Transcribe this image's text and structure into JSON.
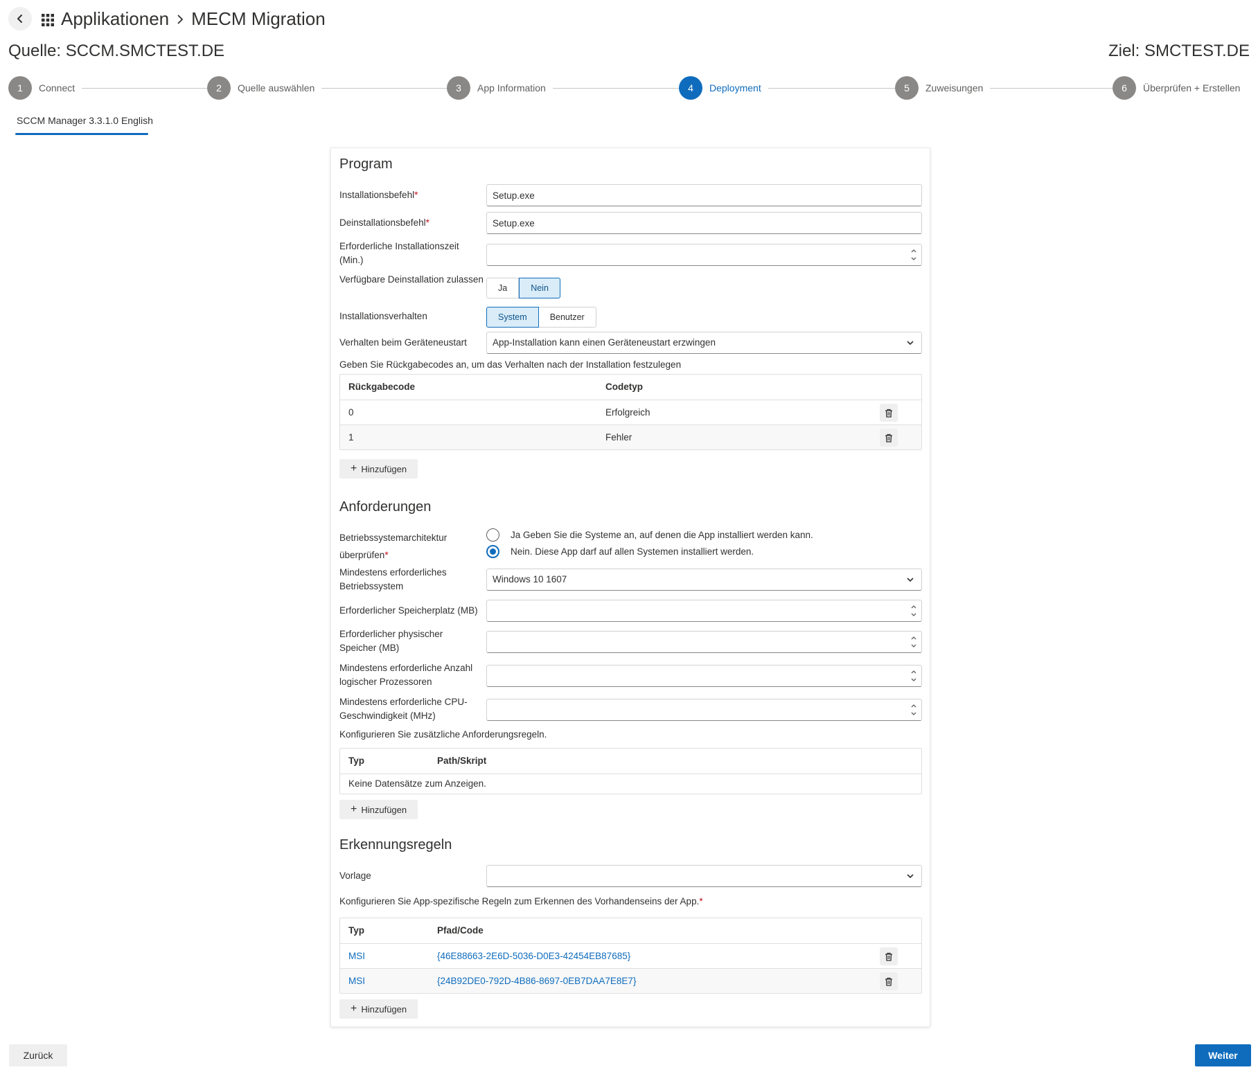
{
  "header": {
    "breadcrumb": [
      "Applikationen",
      "MECM Migration"
    ],
    "source": "Quelle: SCCM.SMCTEST.DE",
    "target": "Ziel: SMCTEST.DE"
  },
  "stepper": {
    "active_step": 4,
    "steps": [
      {
        "num": "1",
        "label": "Connect"
      },
      {
        "num": "2",
        "label": "Quelle auswählen"
      },
      {
        "num": "3",
        "label": "App Information"
      },
      {
        "num": "4",
        "label": "Deployment"
      },
      {
        "num": "5",
        "label": "Zuweisungen"
      },
      {
        "num": "6",
        "label": "Überprüfen + Erstellen"
      }
    ]
  },
  "tab": {
    "label": "SCCM Manager 3.3.1.0 English"
  },
  "program": {
    "title": "Program",
    "install_cmd": {
      "label": "Installationsbefehl",
      "value": "Setup.exe"
    },
    "uninstall_cmd": {
      "label": "Deinstallationsbefehl",
      "value": "Setup.exe"
    },
    "install_time": {
      "label": "Erforderliche Installationszeit (Min.)",
      "value": ""
    },
    "allow_uninstall": {
      "label": "Verfügbare Deinstallation zulassen",
      "options": [
        "Ja",
        "Nein"
      ],
      "selected": "Nein"
    },
    "install_behavior": {
      "label": "Installationsverhalten",
      "options": [
        "System",
        "Benutzer"
      ],
      "selected": "System"
    },
    "restart_behavior": {
      "label": "Verhalten beim Geräteneustart",
      "value": "App-Installation kann einen Geräteneustart erzwingen"
    },
    "return_codes_hint": "Geben Sie Rückgabecodes an, um das Verhalten nach der Installation festzulegen",
    "return_codes": {
      "headers": [
        "Rückgabecode",
        "Codetyp"
      ],
      "rows": [
        {
          "code": "0",
          "type": "Erfolgreich"
        },
        {
          "code": "1",
          "type": "Fehler"
        }
      ]
    },
    "add_label": "Hinzufügen"
  },
  "requirements": {
    "title": "Anforderungen",
    "os_arch": {
      "label": "Betriebssystemarchitektur überprüfen",
      "options": [
        "Ja Geben Sie die Systeme an, auf denen die App installiert werden kann.",
        "Nein. Diese App darf auf allen Systemen installiert werden."
      ],
      "selected_index": 1
    },
    "min_os": {
      "label": "Mindestens erforderliches Betriebssystem",
      "value": "Windows 10 1607"
    },
    "disk_space": {
      "label": "Erforderlicher Speicherplatz (MB)",
      "value": ""
    },
    "phys_memory": {
      "label": "Erforderlicher physischer Speicher (MB)",
      "value": ""
    },
    "logical_procs": {
      "label": "Mindestens erforderliche Anzahl logischer Prozessoren",
      "value": ""
    },
    "cpu_speed": {
      "label": "Mindestens erforderliche CPU-Geschwindigkeit (MHz)",
      "value": ""
    },
    "rules_hint": "Konfigurieren Sie zusätzliche Anforderungsregeln.",
    "rules": {
      "headers": [
        "Typ",
        "Path/Skript"
      ],
      "empty": "Keine Datensätze zum Anzeigen."
    },
    "add_label": "Hinzufügen"
  },
  "detection": {
    "title": "Erkennungsregeln",
    "template": {
      "label": "Vorlage",
      "value": ""
    },
    "rules_hint": "Konfigurieren Sie App-spezifische Regeln zum Erkennen des Vorhandenseins der App.",
    "rules": {
      "headers": [
        "Typ",
        "Pfad/Code"
      ],
      "rows": [
        {
          "type": "MSI",
          "code": "{46E88663-2E6D-5036-D0E3-42454EB87685}"
        },
        {
          "type": "MSI",
          "code": "{24B92DE0-792D-4B86-8697-0EB7DAA7E8E7}"
        }
      ]
    },
    "add_label": "Hinzufügen"
  },
  "footer": {
    "back": "Zurück",
    "next": "Weiter"
  },
  "colors": {
    "accent": "#0f6cbd",
    "required": "#c50f1f",
    "step_inactive": "#8a8886"
  }
}
